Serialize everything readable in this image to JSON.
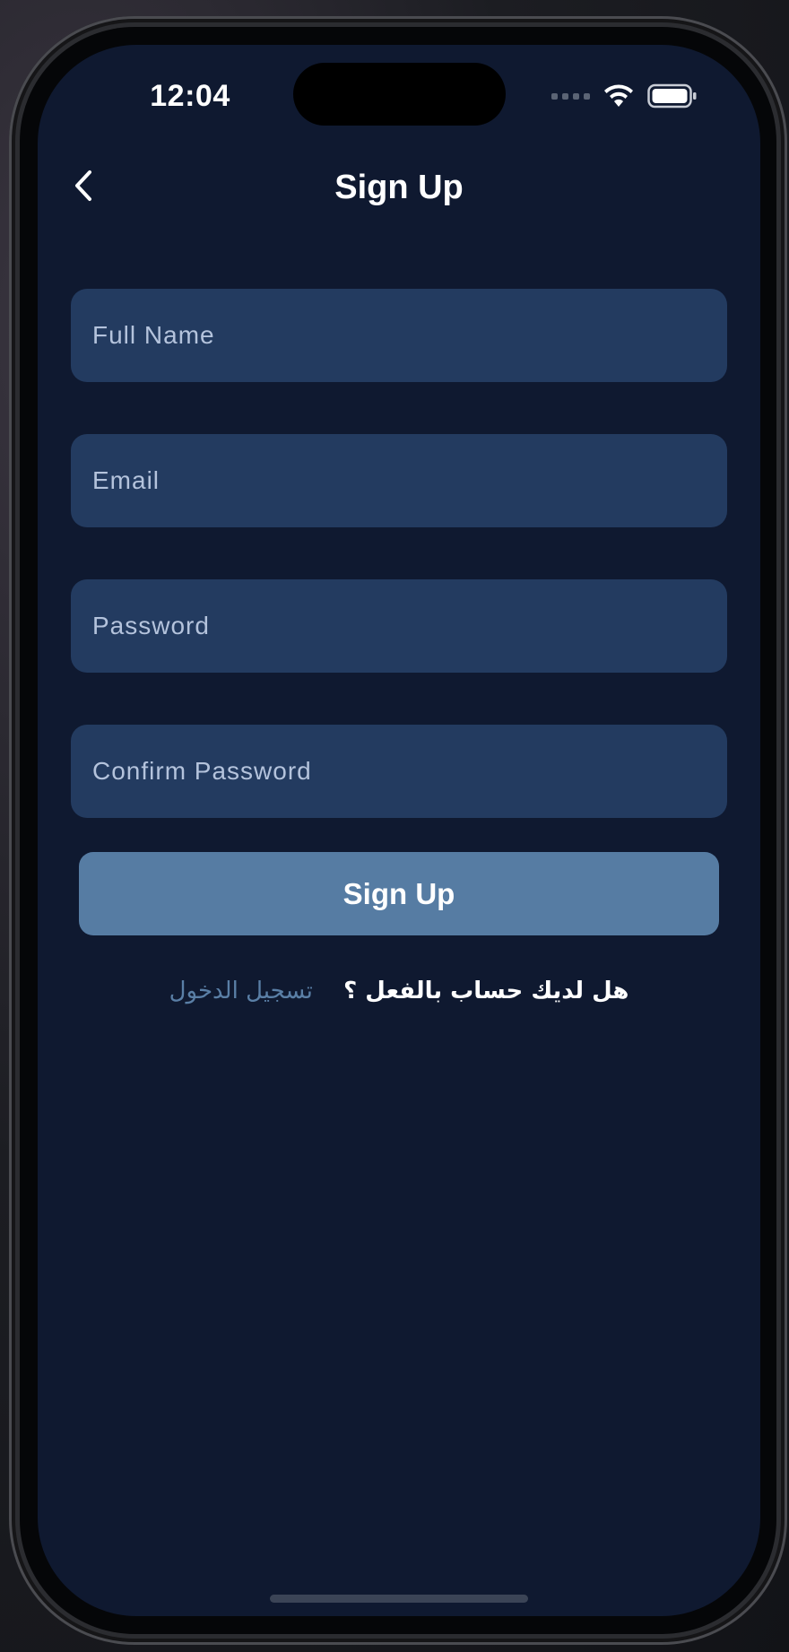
{
  "status_bar": {
    "time": "12:04",
    "signal_icon": "signal-dots-icon",
    "wifi_icon": "wifi-icon",
    "battery_icon": "battery-icon"
  },
  "header": {
    "title": "Sign Up",
    "back_icon": "chevron-left-icon"
  },
  "form": {
    "full_name_placeholder": "Full Name",
    "email_placeholder": "Email",
    "password_placeholder": "Password",
    "confirm_password_placeholder": "Confirm Password",
    "submit_label": "Sign Up"
  },
  "login_prompt": {
    "question": "هل لديك حساب بالفعل ؟",
    "link": "تسجيل الدخول"
  },
  "colors": {
    "background": "#0f1930",
    "field": "#233b60",
    "button": "#567ca3",
    "link": "#5a7fa6"
  }
}
